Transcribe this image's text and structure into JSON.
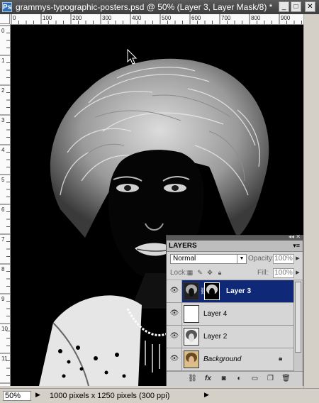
{
  "window": {
    "title": "grammys-typographic-posters.psd @ 50% (Layer 3, Layer Mask/8) *",
    "app_icon": "Ps",
    "controls": [
      "minimize-icon",
      "maximize-icon",
      "close-icon"
    ]
  },
  "rulers": {
    "top_labels": [
      "0",
      "100",
      "200",
      "300",
      "400",
      "500",
      "600",
      "700",
      "800",
      "900"
    ],
    "left_labels": [
      "0",
      "1",
      "2",
      "3",
      "4",
      "5",
      "6",
      "7",
      "8",
      "9",
      "10",
      "11"
    ]
  },
  "status": {
    "zoom": "50%",
    "doc_info": "1000 pixels x 1250 pixels (300 ppi)"
  },
  "layers_panel": {
    "tab": "LAYERS",
    "blend_mode": "Normal",
    "opacity_label": "Opacity:",
    "opacity_value": "100%",
    "lock_label": "Lock:",
    "fill_label": "Fill:",
    "fill_value": "100%",
    "layers": [
      {
        "name": "Layer 3",
        "selected": true,
        "has_mask": true,
        "italic": false
      },
      {
        "name": "Layer 4",
        "selected": false,
        "has_mask": false,
        "italic": false
      },
      {
        "name": "Layer 2",
        "selected": false,
        "has_mask": false,
        "italic": false
      },
      {
        "name": "Background",
        "selected": false,
        "has_mask": false,
        "italic": true,
        "locked": true
      }
    ],
    "footer_icons": [
      "link-icon",
      "fx-icon",
      "mask-icon",
      "adjustment-icon",
      "group-icon",
      "new-layer-icon",
      "trash-icon"
    ]
  },
  "colors": {
    "selected_layer": "#0f2878",
    "canvas": "#000000"
  }
}
